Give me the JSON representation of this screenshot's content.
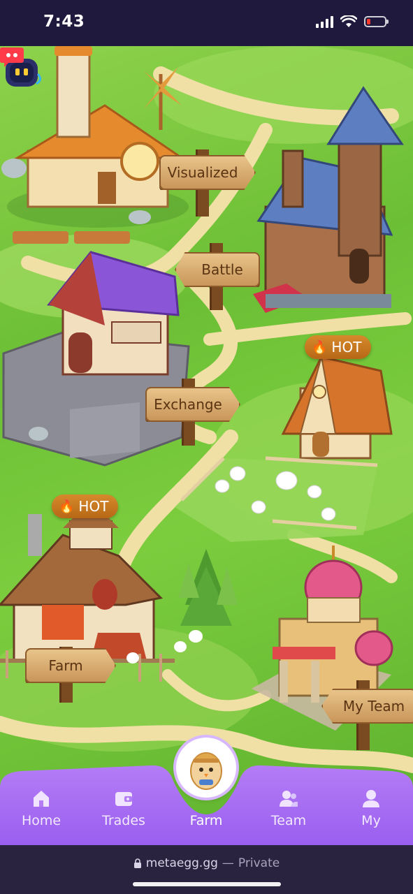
{
  "status_bar": {
    "time": "7:43",
    "icons": [
      "cellular-signal-icon",
      "wifi-icon",
      "battery-low-icon"
    ],
    "battery_level": 0.2
  },
  "map": {
    "locations": [
      {
        "id": "visualized",
        "label": "Visualized"
      },
      {
        "id": "battle",
        "label": "Battle"
      },
      {
        "id": "exchange",
        "label": "Exchange"
      },
      {
        "id": "farm",
        "label": "Farm"
      },
      {
        "id": "my-team",
        "label": "My Team"
      }
    ],
    "badges": [
      {
        "text": "HOT",
        "icon": "flame-icon"
      },
      {
        "text": "HOT",
        "icon": "flame-icon"
      }
    ],
    "support_bot_icon": "robot-chat-icon"
  },
  "bottom_nav": {
    "items": [
      {
        "label": "Home",
        "icon": "home-icon"
      },
      {
        "label": "Trades",
        "icon": "wallet-icon"
      },
      {
        "label": "Farm",
        "icon": "egg-mascot-icon"
      },
      {
        "label": "Team",
        "icon": "team-icon"
      },
      {
        "label": "My",
        "icon": "profile-icon"
      }
    ],
    "active": "Farm",
    "colors": {
      "bar": "#a56cf0",
      "active_ring": "#d7b8ff"
    }
  },
  "browser": {
    "url": "metaegg.gg",
    "separator": "—",
    "mode": "Private",
    "lock_icon": "lock-icon"
  }
}
